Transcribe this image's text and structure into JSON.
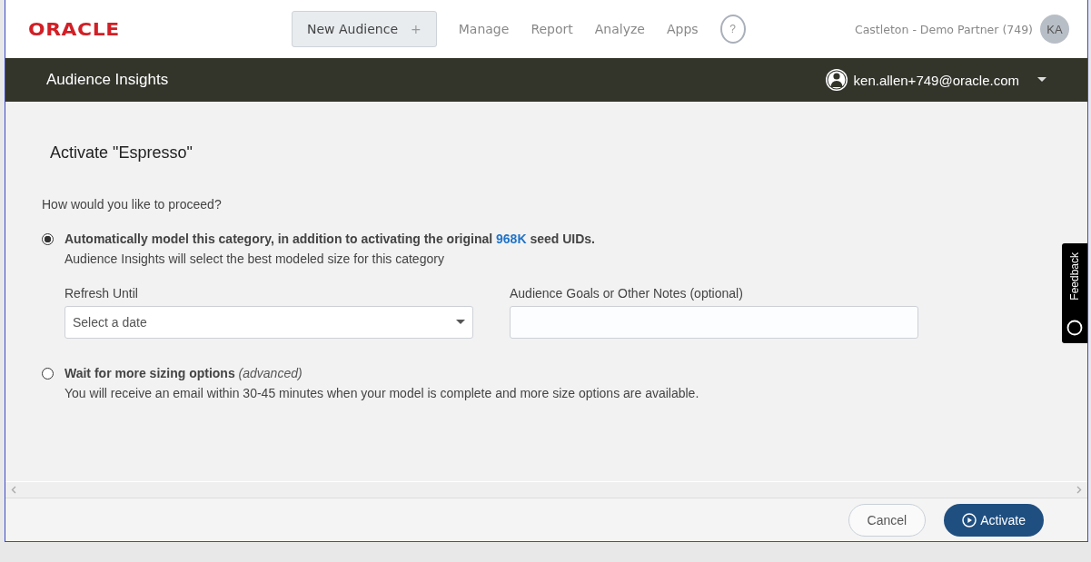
{
  "header": {
    "logo": "ORACLE",
    "new_button": {
      "label": "New Audience",
      "icon": "+"
    },
    "nav": [
      {
        "label": "Manage"
      },
      {
        "label": "Report"
      },
      {
        "label": "Analyze"
      },
      {
        "label": "Apps"
      }
    ],
    "help": "?",
    "account": "Castleton - Demo Partner (749)",
    "avatar": "KA"
  },
  "subheader": {
    "title": "Audience Insights",
    "user": "ken.allen+749@oracle.com"
  },
  "page": {
    "title": "Activate \"Espresso\"",
    "question": "How would you like to proceed?",
    "options": [
      {
        "selected": true,
        "parts": [
          {
            "text": "Automatically model this category, in addition to activating the original ",
            "kind": "strong"
          },
          {
            "text": "968K",
            "kind": "accent"
          },
          {
            "text": " seed UIDs.",
            "kind": "strong"
          }
        ],
        "description": "Audience Insights will select the best modeled size for this category",
        "fields": [
          {
            "kind": "select",
            "label": "Refresh Until",
            "placeholder": "Select a date"
          },
          {
            "kind": "text",
            "label": "Audience Goals or Other Notes (optional)"
          }
        ]
      },
      {
        "selected": false,
        "parts": [
          {
            "text": "Wait for more sizing options ",
            "kind": "strong"
          },
          {
            "text": "(advanced)",
            "kind": "note"
          }
        ],
        "description": "You will receive an email within 30-45 minutes when your model is complete and more size options are available."
      }
    ]
  },
  "feedback": "Feedback",
  "footer": {
    "buttons": [
      {
        "label": "Cancel",
        "kind": "secondary"
      },
      {
        "label": "Activate",
        "kind": "primary"
      }
    ]
  }
}
